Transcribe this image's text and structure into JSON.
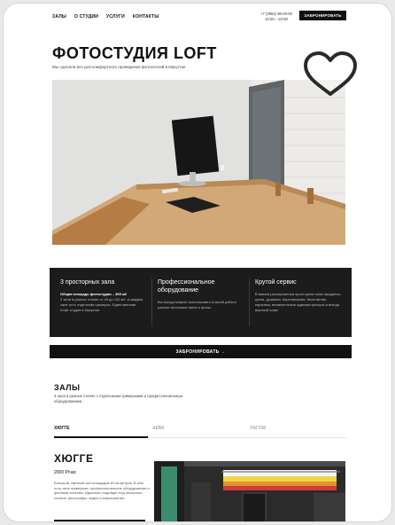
{
  "nav": {
    "items": [
      "ЗАЛЫ",
      "О СТУДИИ",
      "УСЛУГИ",
      "КОНТАКТЫ"
    ],
    "phone": "+7 (3952) 96-00-00",
    "hours": "10:00 – 22:00",
    "book_label": "ЗАБРОНИРОВАТЬ"
  },
  "hero": {
    "title": "ФОТОСТУДИЯ LOFT",
    "subtitle": "Мы сделали все для комфортного проведения фотосессий в Иркутске"
  },
  "features": [
    {
      "title": "3 просторных зала",
      "strong": "Общая площадь фотостудии – 365 м2",
      "text": "3 зала в разных стилях от 40 до 120 м2, в каждом зале есть отдельная гримерка. Единственная лофт-студия в Иркутске"
    },
    {
      "title": "Профессиональное оборудование",
      "strong": "",
      "text": "Вы всегда можете использовать в своей работе разные источники света и фоны."
    },
    {
      "title": "Крутой сервис",
      "strong": "",
      "text": "В вашем распоряжении просторная зона ожидания, кухня, душевая, переговорная, бесплатная парковка, внимательные администраторы и всегда вкусный кофе."
    }
  ],
  "book_bar_label": "ЗАБРОНИРОВАТЬ →",
  "halls": {
    "title": "ЗАЛЫ",
    "subtitle": "3 зала в разных стилях с отдельными гримерками и профессиональным оборудованием",
    "tabs": [
      "ХЮГГЕ",
      "АКВА",
      "ЛАГОМ"
    ]
  },
  "room": {
    "title": "ХЮГГЕ",
    "price": "2000 Р/час",
    "description": "Большой, светлый зал площадью 63 кв.метров. В нем есть своя гримерная, профессиональное оборудование и фоновая система. Идеально подойдет под несколько съемок: фотографы, видео и мероприятия."
  },
  "icons": {
    "favorite": "heart-outline-icon"
  },
  "colors": {
    "dark": "#1c1c1c",
    "accent": "#111111"
  }
}
